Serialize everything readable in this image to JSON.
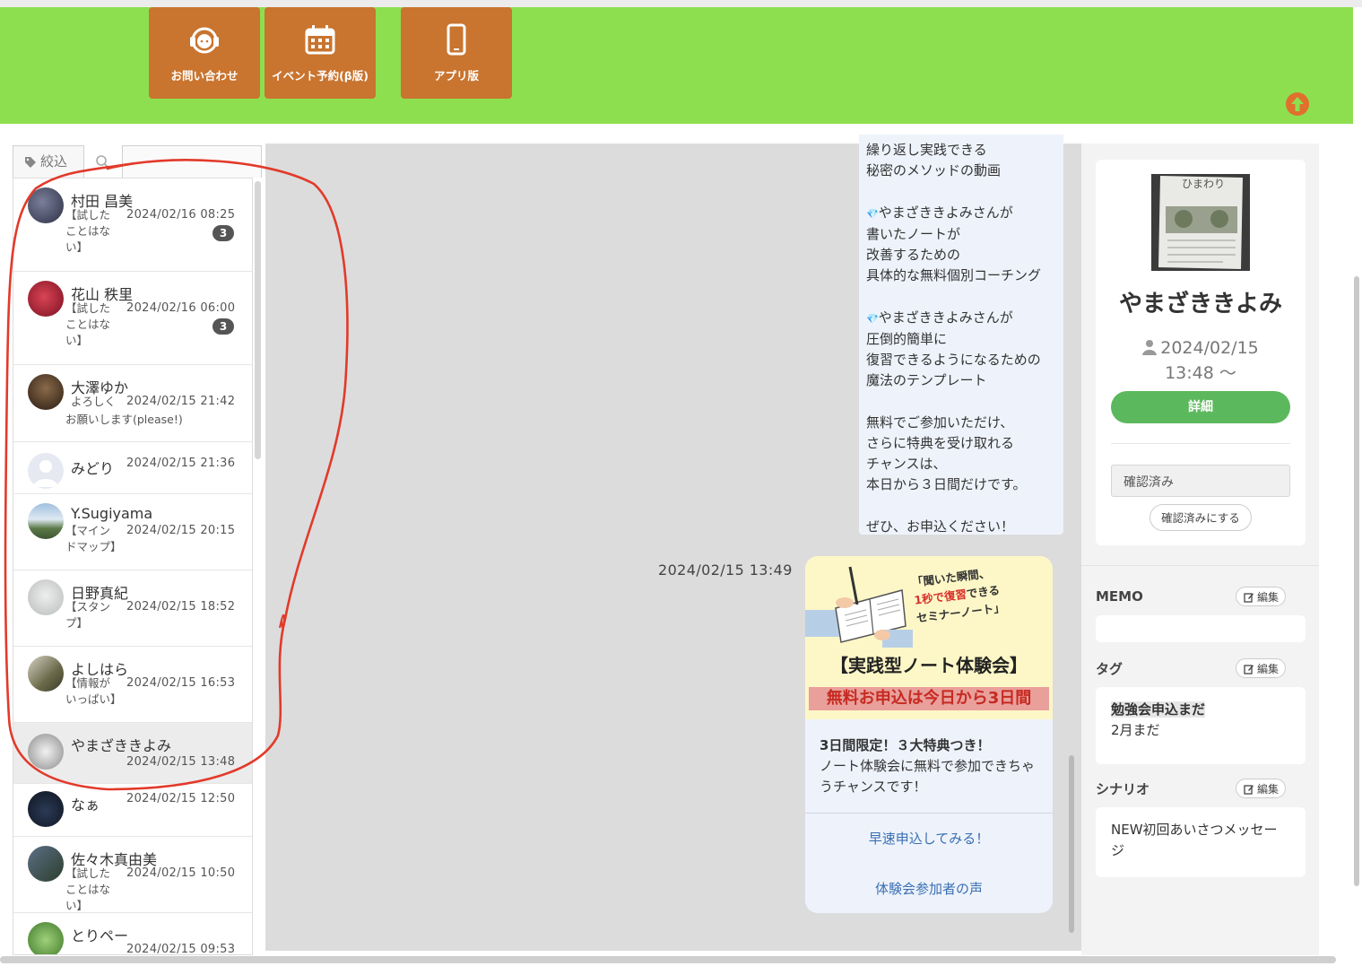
{
  "header": {
    "buttons": [
      {
        "label": "お問い合わせ",
        "icon": "headset-icon"
      },
      {
        "label": "イベント予約(β版)",
        "icon": "calendar-icon"
      },
      {
        "label": "アプリ版",
        "icon": "smartphone-icon"
      }
    ]
  },
  "filter": {
    "tab_label": "絞込"
  },
  "conversations": [
    {
      "name": "村田 昌美",
      "snippet": "【試した ことはな い】",
      "time": "2024/02/16 08:25",
      "badge": "3"
    },
    {
      "name": "花山 秩里",
      "snippet": "【試した ことはな い】",
      "time": "2024/02/16 06:00",
      "badge": "3"
    },
    {
      "name": "大澤ゆか",
      "snippet": "よろしく",
      "snippet2": "お願いします(please!)",
      "time": "2024/02/15 21:42"
    },
    {
      "name": "みどり",
      "time": "2024/02/15 21:36"
    },
    {
      "name": "Y.Sugiyama",
      "snippet": "【マイン ドマップ】",
      "time": "2024/02/15 20:15"
    },
    {
      "name": "日野真紀",
      "snippet": "【スタン プ】",
      "time": "2024/02/15 18:52"
    },
    {
      "name": "よしはら",
      "snippet": "【情報が いっぱい】",
      "time": "2024/02/15 16:53"
    },
    {
      "name": "やまざききよみ",
      "time": "2024/02/15 13:48"
    },
    {
      "name": "なぁ",
      "time": "2024/02/15 12:50"
    },
    {
      "name": "佐々木真由美",
      "snippet": "【試した ことはない】",
      "time": "2024/02/15 10:50"
    },
    {
      "name": "とりペー",
      "time": "2024/02/15 09:53"
    }
  ],
  "chat": {
    "text_message": {
      "lines": [
        "繰り返し実践できる",
        "秘密のメソッドの動画",
        "",
        "やまざききよみさんが",
        "書いたノートが",
        "改善するための",
        "具体的な無料個別コーチング",
        "",
        "やまざききよみさんが",
        "圧倒的簡単に",
        "復習できるようになるための",
        "魔法のテンプレート",
        "",
        "無料でご参加いただけ、",
        "さらに特典を受け取れる",
        "チャンスは、",
        "本日から３日間だけです。",
        "",
        "ぜひ、お申込ください！"
      ]
    },
    "card_message": {
      "time": "2024/02/15 13:49",
      "image_quote_1": "「聞いた瞬間、",
      "image_quote_2a": "1秒で",
      "image_quote_2b": "復習",
      "image_quote_2c": "できる",
      "image_quote_3": "セミナーノート」",
      "image_title": "【実践型ノート体験会】",
      "image_subtitle": "無料お申込は今日から3日間",
      "body_title": "3日間限定！３大特典つき！",
      "body_text": "ノート体験会に無料で参加できちゃうチャンスです！",
      "link1": "早速申込してみる！",
      "link2": "体験会参加者の声"
    }
  },
  "profile": {
    "photo_text": "ひまわり",
    "name": "やまざききよみ",
    "date": "2024/02/15",
    "time": "13:48 〜",
    "detail_button": "詳細",
    "status": "確認済み",
    "confirm_button": "確認済みにする",
    "memo_title": "MEMO",
    "tag_title": "タグ",
    "tag_value": "勉強会申込まだ",
    "tag_value2": "2月まだ",
    "scenario_title": "シナリオ",
    "scenario_value": "NEW初回あいさつメッセージ",
    "edit_label": "編集"
  },
  "colors": {
    "header_bg": "#8ddf4f",
    "header_button": "#c9742f",
    "detail_button": "#5cb85c",
    "annotation": "#e23a2a"
  }
}
